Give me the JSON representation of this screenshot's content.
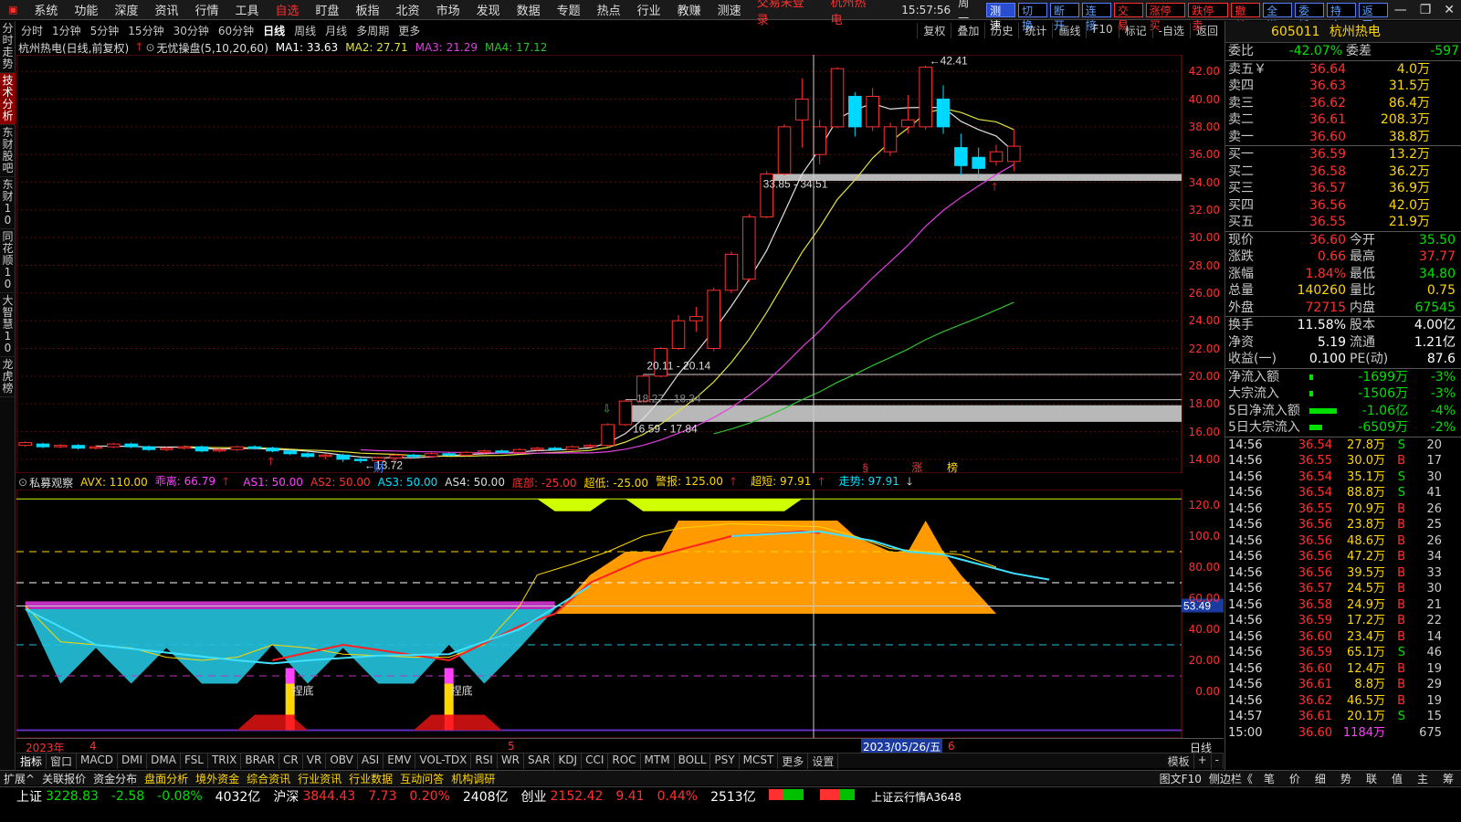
{
  "menu": [
    "系统",
    "功能",
    "深度",
    "资讯",
    "行情",
    "工具"
  ],
  "menu_hl": "自选",
  "menu2": [
    "盯盘",
    "板指",
    "北资",
    "市场",
    "发现",
    "数据",
    "专题",
    "热点",
    "行业",
    "教赚",
    "测速"
  ],
  "warn1": "交易未登录",
  "warn2": "杭州热电",
  "clock": "15:57:56",
  "weekday": "周一",
  "quick_btns": [
    "测速",
    "切换",
    "断开",
    "连接",
    "交易",
    "涨停买",
    "跌停卖",
    "撤单",
    "全撤",
    "委托",
    "持仓",
    "返回"
  ],
  "left_tabs": [
    "分时走势",
    "技术分析",
    "东财股吧",
    "东财10",
    "同花顺10",
    "大智慧10",
    "龙虎榜"
  ],
  "periods": [
    "分时",
    "1分钟",
    "5分钟",
    "15分钟",
    "30分钟",
    "60分钟",
    "日线",
    "周线",
    "月线",
    "多周期",
    "更多"
  ],
  "tools": [
    "复权",
    "叠加",
    "历史",
    "统计",
    "画线",
    "F10",
    "标记",
    "-自选",
    "返回"
  ],
  "main": {
    "title": "杭州热电(日线,前复权)",
    "indicator": "无忧操盘(5,10,20,60)",
    "ma1": "MA1: 33.63",
    "ma2": "MA2: 27.71",
    "ma3": "MA3: 21.29",
    "ma4": "MA4: 17.12",
    "ylabels": [
      "42.00",
      "40.00",
      "38.00",
      "36.00",
      "34.00",
      "32.00",
      "30.00",
      "28.00",
      "26.00",
      "24.00",
      "22.00",
      "20.00",
      "18.00",
      "16.00",
      "14.00"
    ],
    "ann_high": "42.41",
    "ann_band1": "33.85 - 34.51",
    "ann_band2": "20.11 - 20.14",
    "ann_band3": "18.27 - 18.34",
    "ann_band4": "16.59 - 17.84",
    "ann_low": "13.72",
    "marks": [
      "财",
      "§",
      "涨",
      "榜"
    ]
  },
  "sub": {
    "name": "私募观察",
    "avx": "AVX: 110.00",
    "chl": "乖离: 66.79",
    "as1": "AS1: 50.00",
    "as2": "AS2: 50.00",
    "as3": "AS3: 50.00",
    "as4": "AS4: 50.00",
    "dibu": "底部: -25.00",
    "chaodi": "超低: -25.00",
    "jingbao": "警报: 125.00",
    "chaoduan": "超短: 97.91",
    "zoushi": "走势: 97.91",
    "ylabels": [
      "120.0",
      "100.0",
      "80.00",
      "60.00",
      "40.00",
      "20.00",
      "0.00"
    ],
    "cur_value": "53.49",
    "dinglabel": "捏底"
  },
  "xaxis": {
    "year": "2023年",
    "m4": "4",
    "m5": "5",
    "m6": "6",
    "cursor": "2023/05/26/五",
    "period": "日线"
  },
  "indicators": [
    "指标",
    "窗口",
    "MACD",
    "DMI",
    "DMA",
    "FSL",
    "TRIX",
    "BRAR",
    "CR",
    "VR",
    "OBV",
    "ASI",
    "EMV",
    "VOL-TDX",
    "RSI",
    "WR",
    "SAR",
    "KDJ",
    "CCI",
    "ROC",
    "MTM",
    "BOLL",
    "PSY",
    "MCST",
    "更多",
    "设置"
  ],
  "ind_right": [
    "模板",
    "+",
    "-"
  ],
  "bottom_tabs": [
    "扩展^",
    "关联报价",
    "资金分布",
    "盘面分析",
    "境外资金",
    "综合资讯",
    "行业资讯",
    "行业数据",
    "互动问答",
    "机构调研"
  ],
  "bottom_right": [
    "图文F10",
    "侧边栏《",
    "笔",
    "价",
    "细",
    "势",
    "联",
    "值",
    "主",
    "筹"
  ],
  "quote": {
    "code": "605011",
    "name": "杭州热电",
    "weibi_l": "委比",
    "weibi": "-42.07%",
    "weicha_l": "委差",
    "weicha": "-597",
    "sells": [
      {
        "label": "卖五￥",
        "price": "36.64",
        "vol": "4.0万"
      },
      {
        "label": "卖四",
        "price": "36.63",
        "vol": "31.5万"
      },
      {
        "label": "卖三",
        "price": "36.62",
        "vol": "86.4万"
      },
      {
        "label": "卖二",
        "price": "36.61",
        "vol": "208.3万"
      },
      {
        "label": "卖一",
        "price": "36.60",
        "vol": "38.8万"
      }
    ],
    "buys": [
      {
        "label": "买一",
        "price": "36.59",
        "vol": "13.2万"
      },
      {
        "label": "买二",
        "price": "36.58",
        "vol": "36.2万"
      },
      {
        "label": "买三",
        "price": "36.57",
        "vol": "36.9万"
      },
      {
        "label": "买四",
        "price": "36.56",
        "vol": "42.0万"
      },
      {
        "label": "买五",
        "price": "36.55",
        "vol": "21.9万"
      }
    ],
    "stats": [
      {
        "l1": "现价",
        "v1": "36.60",
        "c1": "red",
        "l2": "今开",
        "v2": "35.50",
        "c2": "green"
      },
      {
        "l1": "涨跌",
        "v1": "0.66",
        "c1": "red",
        "l2": "最高",
        "v2": "37.77",
        "c2": "red"
      },
      {
        "l1": "涨幅",
        "v1": "1.84%",
        "c1": "red",
        "l2": "最低",
        "v2": "34.80",
        "c2": "green"
      },
      {
        "l1": "总量",
        "v1": "140260",
        "c1": "yel",
        "l2": "量比",
        "v2": "0.75",
        "c2": "yel"
      },
      {
        "l1": "外盘",
        "v1": "72715",
        "c1": "red",
        "l2": "内盘",
        "v2": "67545",
        "c2": "green"
      }
    ],
    "stats2": [
      {
        "l1": "换手",
        "v1": "11.58%",
        "l2": "股本",
        "v2": "4.00亿"
      },
      {
        "l1": "净资",
        "v1": "5.19",
        "l2": "流通",
        "v2": "1.21亿"
      },
      {
        "l1": "收益(一)",
        "v1": "0.100",
        "l2": "PE(动)",
        "v2": "87.6"
      }
    ],
    "flows": [
      {
        "label": "净流入额",
        "val": "-1699万",
        "pct": "-3%",
        "bar": 4
      },
      {
        "label": "大宗流入",
        "val": "-1506万",
        "pct": "-3%",
        "bar": 4
      },
      {
        "label": "5日净流入额",
        "val": "-1.06亿",
        "pct": "-4%",
        "bar": 30
      },
      {
        "label": "5日大宗流入",
        "val": "-6509万",
        "pct": "-2%",
        "bar": 14
      }
    ],
    "ticks": [
      {
        "t": "14:56",
        "p": "36.54",
        "v": "27.8万",
        "b": "S",
        "n": "20"
      },
      {
        "t": "14:56",
        "p": "36.55",
        "v": "30.0万",
        "b": "B",
        "n": "17"
      },
      {
        "t": "14:56",
        "p": "36.54",
        "v": "35.1万",
        "b": "S",
        "n": "30"
      },
      {
        "t": "14:56",
        "p": "36.54",
        "v": "88.8万",
        "b": "S",
        "n": "41"
      },
      {
        "t": "14:56",
        "p": "36.55",
        "v": "70.9万",
        "b": "B",
        "n": "26"
      },
      {
        "t": "14:56",
        "p": "36.56",
        "v": "23.8万",
        "b": "B",
        "n": "25"
      },
      {
        "t": "14:56",
        "p": "36.56",
        "v": "48.6万",
        "b": "B",
        "n": "26"
      },
      {
        "t": "14:56",
        "p": "36.56",
        "v": "47.2万",
        "b": "B",
        "n": "34"
      },
      {
        "t": "14:56",
        "p": "36.56",
        "v": "39.5万",
        "b": "B",
        "n": "33"
      },
      {
        "t": "14:56",
        "p": "36.57",
        "v": "24.5万",
        "b": "B",
        "n": "30"
      },
      {
        "t": "14:56",
        "p": "36.58",
        "v": "24.9万",
        "b": "B",
        "n": "21"
      },
      {
        "t": "14:56",
        "p": "36.59",
        "v": "17.2万",
        "b": "B",
        "n": "22"
      },
      {
        "t": "14:56",
        "p": "36.60",
        "v": "23.4万",
        "b": "B",
        "n": "14"
      },
      {
        "t": "14:56",
        "p": "36.59",
        "v": "65.1万",
        "b": "S",
        "n": "46"
      },
      {
        "t": "14:56",
        "p": "36.60",
        "v": "12.4万",
        "b": "B",
        "n": "19"
      },
      {
        "t": "14:56",
        "p": "36.61",
        "v": "8.8万",
        "b": "B",
        "n": "29"
      },
      {
        "t": "14:56",
        "p": "36.62",
        "v": "46.5万",
        "b": "B",
        "n": "19"
      },
      {
        "t": "14:57",
        "p": "36.61",
        "v": "20.1万",
        "b": "S",
        "n": "15"
      },
      {
        "t": "15:00",
        "p": "36.60",
        "v": "1184万",
        "b": "",
        "n": "675"
      }
    ]
  },
  "status": {
    "sh_l": "上证",
    "sh": "3228.83",
    "sh_c": "-2.58",
    "sh_p": "-0.08%",
    "sh_a": "4032亿",
    "hs_l": "沪深",
    "hs": "3844.43",
    "hs_c": "7.73",
    "hs_p": "0.20%",
    "hs_a": "2408亿",
    "cy_l": "创业",
    "cy": "2152.42",
    "cy_c": "9.41",
    "cy_p": "0.44%",
    "cy_a": "2513亿",
    "cloud": "上证云行情A3648"
  },
  "candles": [
    {
      "d": "0526",
      "o": 15.0,
      "c": 15.2,
      "h": 15.3,
      "l": 14.9
    },
    {
      "o": 15.1,
      "c": 14.9,
      "h": 15.2,
      "l": 14.8
    },
    {
      "o": 14.9,
      "c": 15.0,
      "h": 15.1,
      "l": 14.8
    },
    {
      "o": 15.0,
      "c": 14.8,
      "h": 15.1,
      "l": 14.7
    },
    {
      "o": 14.8,
      "c": 14.9,
      "h": 15.0,
      "l": 14.7
    },
    {
      "o": 14.9,
      "c": 15.1,
      "h": 15.2,
      "l": 14.8
    },
    {
      "o": 15.1,
      "c": 14.9,
      "h": 15.2,
      "l": 14.8
    },
    {
      "o": 14.9,
      "c": 14.7,
      "h": 15.0,
      "l": 14.6
    },
    {
      "o": 14.7,
      "c": 14.8,
      "h": 14.9,
      "l": 14.6
    },
    {
      "o": 14.8,
      "c": 14.9,
      "h": 15.0,
      "l": 14.7
    },
    {
      "o": 14.9,
      "c": 14.6,
      "h": 15.0,
      "l": 14.5
    },
    {
      "o": 14.6,
      "c": 14.7,
      "h": 14.8,
      "l": 14.5
    },
    {
      "o": 14.7,
      "c": 14.9,
      "h": 15.0,
      "l": 14.6
    },
    {
      "o": 14.9,
      "c": 14.8,
      "h": 15.0,
      "l": 14.7
    },
    {
      "o": 14.8,
      "c": 14.6,
      "h": 14.9,
      "l": 14.5
    },
    {
      "o": 14.6,
      "c": 14.4,
      "h": 14.7,
      "l": 14.3
    },
    {
      "o": 14.4,
      "c": 14.2,
      "h": 14.5,
      "l": 14.1
    },
    {
      "o": 14.2,
      "c": 14.3,
      "h": 14.4,
      "l": 14.0
    },
    {
      "o": 14.3,
      "c": 14.0,
      "h": 14.4,
      "l": 13.8
    },
    {
      "o": 14.0,
      "c": 13.9,
      "h": 14.1,
      "l": 13.72
    },
    {
      "o": 13.9,
      "c": 14.1,
      "h": 14.2,
      "l": 13.8
    },
    {
      "o": 14.1,
      "c": 14.3,
      "h": 14.4,
      "l": 14.0
    },
    {
      "o": 14.3,
      "c": 14.2,
      "h": 14.4,
      "l": 14.1
    },
    {
      "o": 14.2,
      "c": 14.4,
      "h": 14.5,
      "l": 14.1
    },
    {
      "o": 14.4,
      "c": 14.3,
      "h": 14.5,
      "l": 14.2
    },
    {
      "o": 14.3,
      "c": 14.5,
      "h": 14.6,
      "l": 14.2
    },
    {
      "o": 14.5,
      "c": 14.6,
      "h": 14.7,
      "l": 14.4
    },
    {
      "o": 14.6,
      "c": 14.5,
      "h": 14.7,
      "l": 14.4
    },
    {
      "o": 14.5,
      "c": 14.7,
      "h": 14.8,
      "l": 14.4
    },
    {
      "o": 14.7,
      "c": 14.8,
      "h": 14.9,
      "l": 14.6
    },
    {
      "o": 14.8,
      "c": 14.7,
      "h": 14.9,
      "l": 14.6
    },
    {
      "o": 14.7,
      "c": 14.9,
      "h": 15.0,
      "l": 14.6
    },
    {
      "o": 14.9,
      "c": 15.0,
      "h": 15.1,
      "l": 14.8
    },
    {
      "o": 15.0,
      "c": 16.5,
      "h": 16.6,
      "l": 14.9
    },
    {
      "o": 16.5,
      "c": 18.2,
      "h": 18.3,
      "l": 16.4
    },
    {
      "o": 18.2,
      "c": 20.0,
      "h": 20.1,
      "l": 18.1
    },
    {
      "o": 20.0,
      "c": 22.0,
      "h": 22.1,
      "l": 19.9
    },
    {
      "o": 22.0,
      "c": 24.0,
      "h": 24.4,
      "l": 21.9
    },
    {
      "o": 24.0,
      "c": 24.3,
      "h": 25.0,
      "l": 23.2
    },
    {
      "o": 22.0,
      "c": 26.2,
      "h": 26.4,
      "l": 21.8
    },
    {
      "o": 26.2,
      "c": 28.8,
      "h": 29.0,
      "l": 26.0
    },
    {
      "o": 27.0,
      "c": 31.5,
      "h": 31.7,
      "l": 26.8
    },
    {
      "o": 31.5,
      "c": 34.6,
      "h": 34.8,
      "l": 31.4
    },
    {
      "o": 34.6,
      "c": 38.0,
      "h": 38.2,
      "l": 34.5
    },
    {
      "o": 38.5,
      "c": 40.0,
      "h": 41.5,
      "l": 36.5
    },
    {
      "o": 36.0,
      "c": 38.0,
      "h": 38.5,
      "l": 35.3
    },
    {
      "o": 38.0,
      "c": 42.2,
      "h": 42.3,
      "l": 37.9
    },
    {
      "o": 40.2,
      "c": 38.0,
      "h": 40.5,
      "l": 37.3
    },
    {
      "o": 38.0,
      "c": 40.2,
      "h": 40.8,
      "l": 37.7
    },
    {
      "o": 36.2,
      "c": 38.0,
      "h": 38.3,
      "l": 35.9
    },
    {
      "o": 38.0,
      "c": 38.5,
      "h": 40.3,
      "l": 37.5
    },
    {
      "o": 38.0,
      "c": 42.3,
      "h": 42.41,
      "l": 37.8
    },
    {
      "o": 40.0,
      "c": 38.0,
      "h": 41.0,
      "l": 37.5
    },
    {
      "o": 36.5,
      "c": 35.2,
      "h": 37.5,
      "l": 34.5
    },
    {
      "o": 35.8,
      "c": 35.0,
      "h": 36.5,
      "l": 34.3
    },
    {
      "o": 35.5,
      "c": 36.2,
      "h": 36.7,
      "l": 35.2
    },
    {
      "o": 35.5,
      "c": 36.6,
      "h": 37.77,
      "l": 34.8
    }
  ],
  "colors": {
    "up": "#ff3030",
    "down": "#00d8ff",
    "ma1": "#e0e0e0",
    "ma2": "#e0e040",
    "ma3": "#e040e0",
    "ma4": "#30c030",
    "band": "#b8b8b8"
  }
}
